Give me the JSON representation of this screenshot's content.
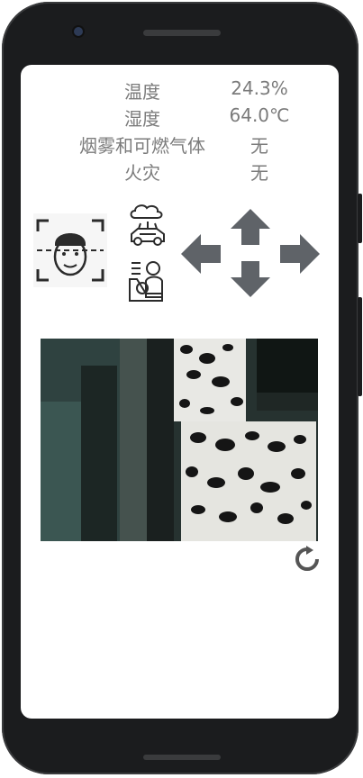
{
  "sensors": [
    {
      "label": "温度",
      "value": "24.3%"
    },
    {
      "label": "湿度",
      "value": "64.0℃"
    },
    {
      "label": "烟雾和可燃气体",
      "value": "无"
    },
    {
      "label": "火灾",
      "value": "无"
    }
  ],
  "icons": {
    "face": "face-scan-icon",
    "car": "smart-car-icon",
    "driver": "driver-control-icon",
    "up": "arrow-up-icon",
    "down": "arrow-down-icon",
    "left": "arrow-left-icon",
    "right": "arrow-right-icon",
    "refresh": "refresh-icon"
  },
  "colors": {
    "arrow": "#5f6368",
    "label_text": "#7b7b7b",
    "phone_frame": "#1b1c1e"
  }
}
